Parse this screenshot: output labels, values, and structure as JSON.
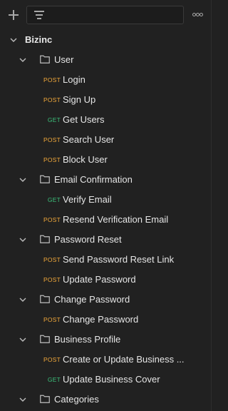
{
  "toolbar": {
    "add_icon": "plus-icon",
    "filter_icon": "filter-icon",
    "more_icon": "more-options-icon"
  },
  "colors": {
    "background": "#212121",
    "post": "#f2a93b",
    "get": "#3cbf7a",
    "text": "#e6e6e6"
  },
  "tree": {
    "root": {
      "label": "Bizinc"
    },
    "user": {
      "label": "User",
      "items": [
        {
          "method": "POST",
          "label": "Login"
        },
        {
          "method": "POST",
          "label": "Sign Up"
        },
        {
          "method": "GET",
          "label": "Get Users"
        },
        {
          "method": "POST",
          "label": "Search User"
        },
        {
          "method": "POST",
          "label": "Block User"
        }
      ]
    },
    "email_confirmation": {
      "label": "Email Confirmation",
      "items": [
        {
          "method": "GET",
          "label": "Verify Email"
        },
        {
          "method": "POST",
          "label": "Resend Verification Email"
        }
      ]
    },
    "password_reset": {
      "label": "Password Reset",
      "items": [
        {
          "method": "POST",
          "label": "Send Password Reset Link"
        },
        {
          "method": "POST",
          "label": "Update Password"
        }
      ]
    },
    "change_password": {
      "label": "Change Password",
      "items": [
        {
          "method": "POST",
          "label": "Change Password"
        }
      ]
    },
    "business_profile": {
      "label": "Business Profile",
      "items": [
        {
          "method": "POST",
          "label": "Create or Update Business ..."
        },
        {
          "method": "GET",
          "label": "Update Business Cover"
        }
      ]
    },
    "categories": {
      "label": "Categories"
    }
  }
}
